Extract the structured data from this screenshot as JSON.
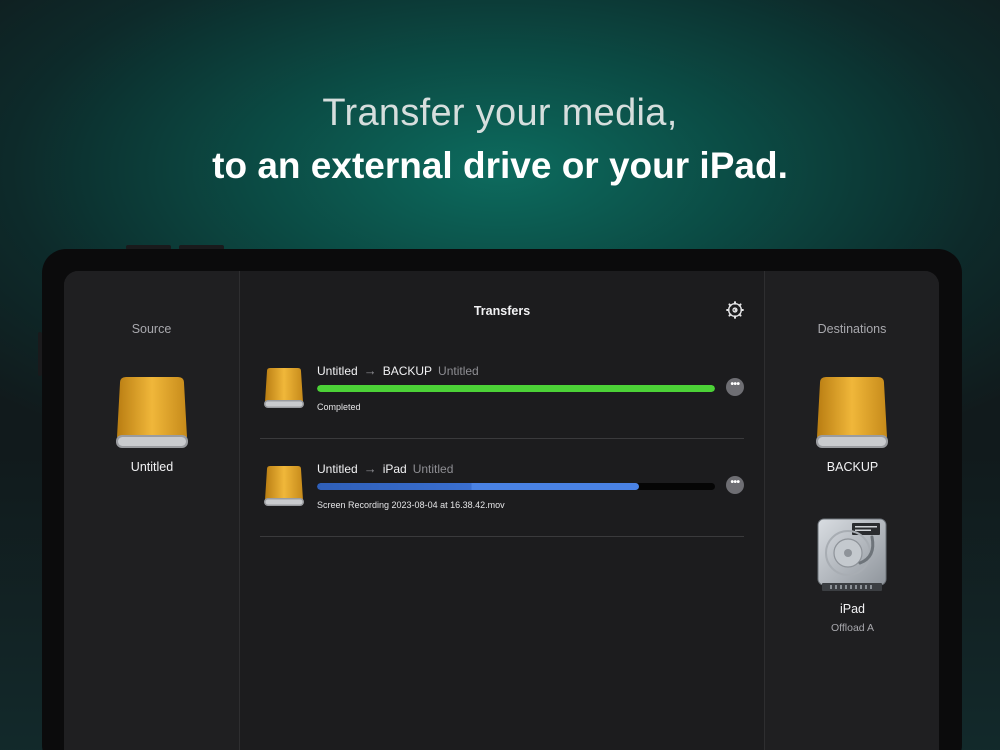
{
  "headline": {
    "line1": "Transfer your media,",
    "line2": "to an external drive or your iPad."
  },
  "colors": {
    "accent_green": "#4cd137",
    "accent_blue": "#3a72d8",
    "drive_gold": "#e3a82e"
  },
  "source": {
    "title": "Source",
    "drive": {
      "name": "Untitled",
      "icon": "external-drive-icon"
    }
  },
  "transfers": {
    "title": "Transfers",
    "settings_icon": "gear-icon",
    "items": [
      {
        "from": "Untitled",
        "to": "BACKUP",
        "volume": "Untitled",
        "status": "Completed",
        "progress": 1.0,
        "bar_color": "#4cd137"
      },
      {
        "from": "Untitled",
        "to": "iPad",
        "volume": "Untitled",
        "status": "Screen Recording 2023-08-04 at 16.38.42.mov",
        "progress": 0.81,
        "bar_color": "#3a72d8"
      }
    ]
  },
  "destinations": {
    "title": "Destinations",
    "items": [
      {
        "name": "BACKUP",
        "subtitle": "",
        "icon": "external-drive-icon"
      },
      {
        "name": "iPad",
        "subtitle": "Offload A",
        "icon": "internal-hard-drive-icon"
      }
    ]
  }
}
